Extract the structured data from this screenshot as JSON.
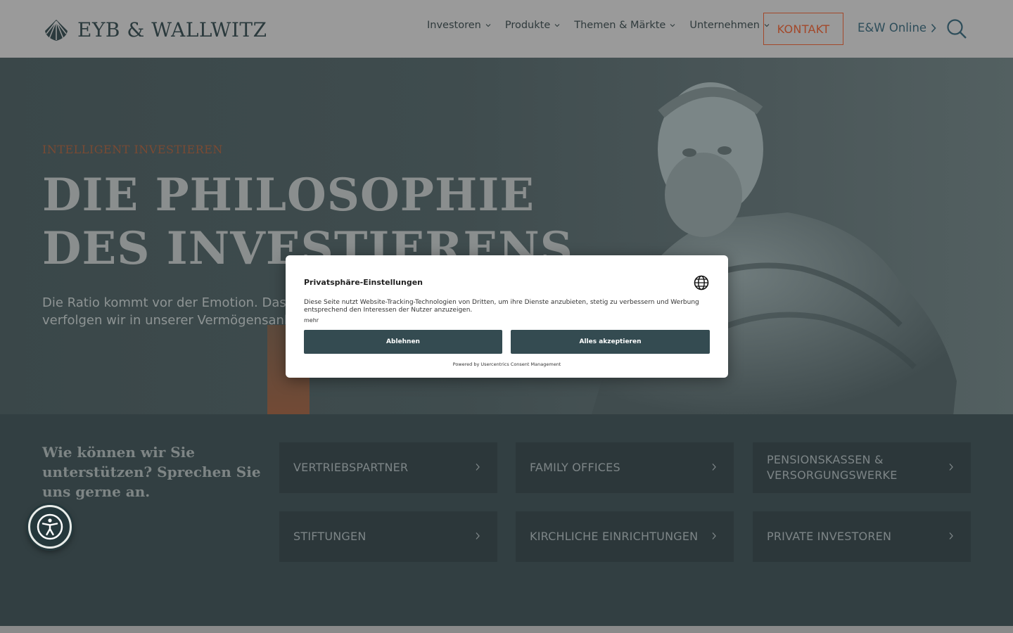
{
  "header": {
    "logo_text": "EYB & WALLWITZ",
    "nav": [
      "Investoren",
      "Produkte",
      "Themen & Märkte",
      "Unternehmen"
    ],
    "contact_label": "KONTAKT",
    "online_label": "E&W Online"
  },
  "hero": {
    "eyebrow": "INTELLIGENT INVESTIEREN",
    "headline": "DIE PHILOSOPHIE DES INVESTIERENS",
    "text": "Die Ratio kommt vor der Emotion. Das ha verfolgen wir in unserer Vermögensanlag"
  },
  "support": {
    "title": "Wie können wir Sie unterstützen? Sprechen Sie uns gerne an.",
    "cards": [
      "VERTRIEBSPARTNER",
      "FAMILY OFFICES",
      "PENSIONSKASSEN & VERSORGUNGSWERKE",
      "STIFTUNGEN",
      "KIRCHLICHE EINRICHTUNGEN",
      "PRIVATE INVESTOREN"
    ]
  },
  "consent": {
    "title": "Privatsphäre-Einstellungen",
    "description": "Diese Seite nutzt Website-Tracking-Technologien von Dritten, um ihre Dienste anzubieten, stetig zu verbessern und Werbung entsprechend den Interessen der Nutzer anzuzeigen.",
    "more": "mehr",
    "decline": "Ablehnen",
    "accept": "Alles akzeptieren",
    "powered_by": "Powered by Usercentrics Consent Management"
  },
  "colors": {
    "accent": "#a3482a",
    "primary_button": "#344b51",
    "header_bg": "#9a9a9a"
  }
}
